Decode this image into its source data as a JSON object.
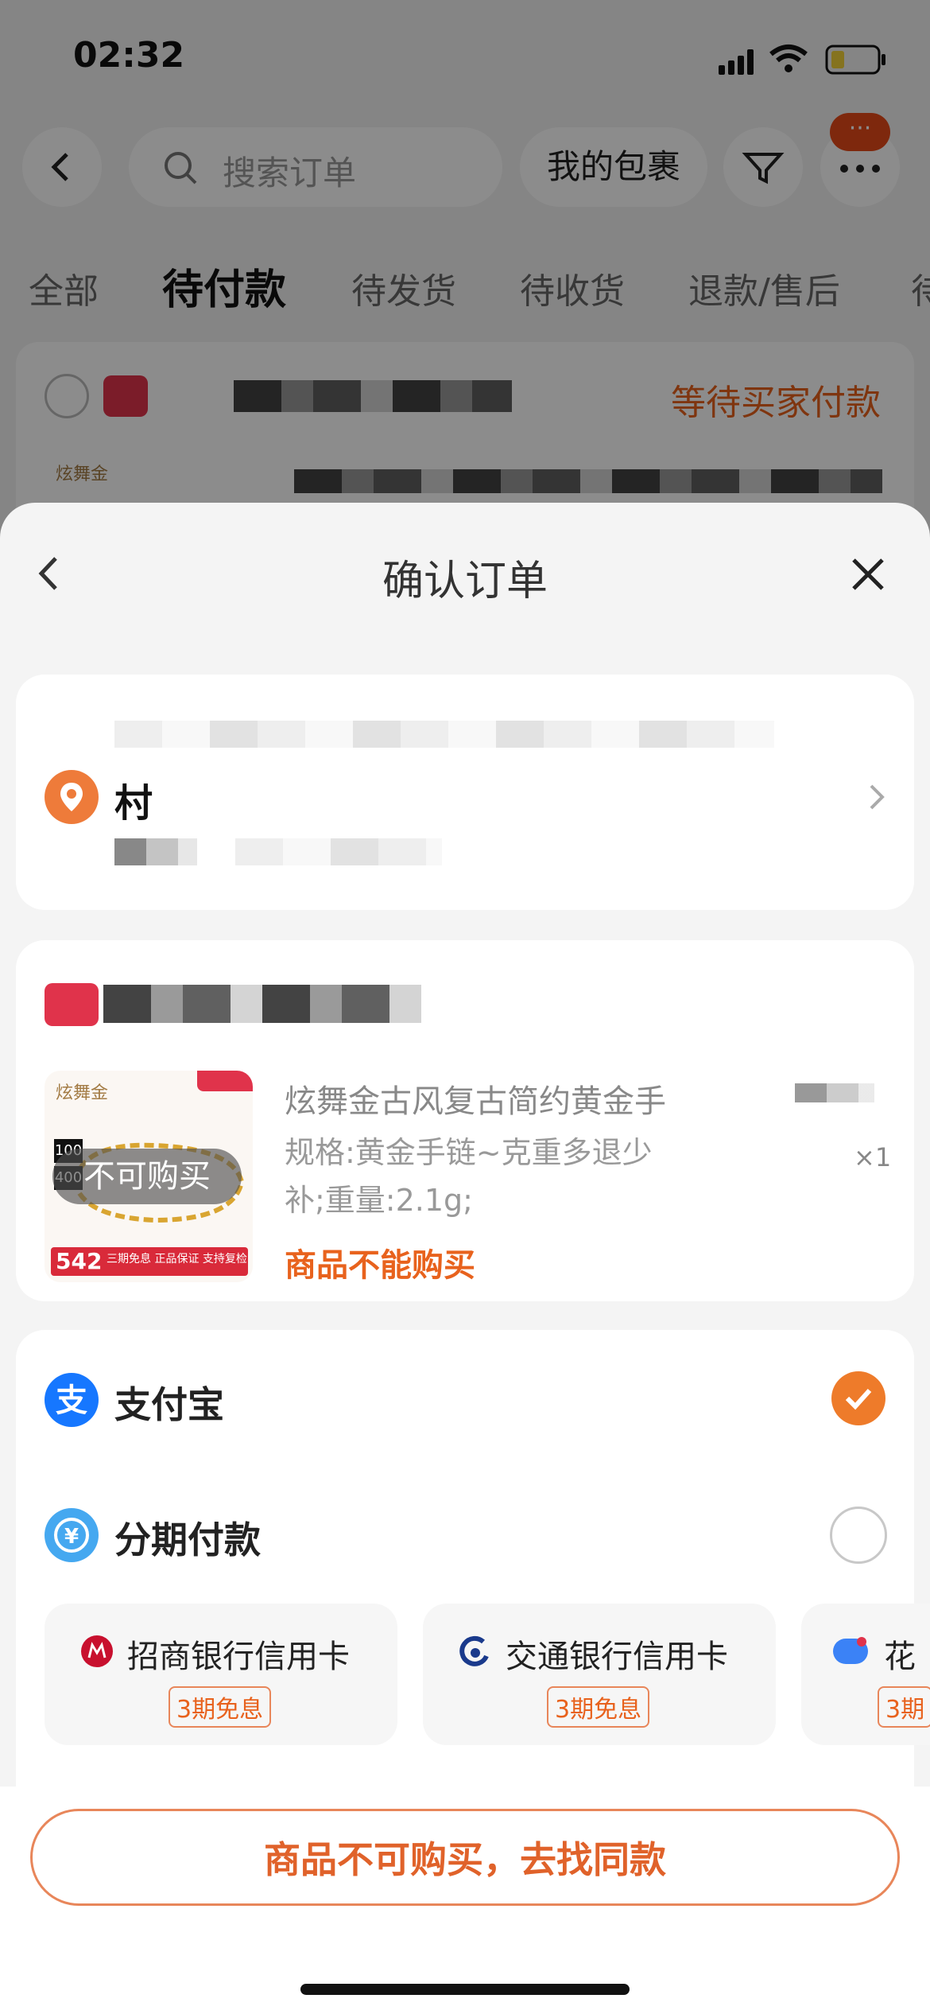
{
  "status_bar": {
    "time": "02:32"
  },
  "background": {
    "search_placeholder": "搜索订单",
    "my_parcels": "我的包裹",
    "more_badge": "···",
    "tabs": [
      "全部",
      "待付款",
      "待发货",
      "待收货",
      "退款/售后",
      "待"
    ],
    "active_tab_index": 1,
    "order_status": "等待买家付款",
    "shop_thumb_text": "炫舞金"
  },
  "sheet": {
    "title": "确认订单",
    "address": {
      "name": "村"
    },
    "product": {
      "brand": "炫舞金",
      "title": "炫舞金古风复古简约黄金手",
      "spec_line1": "规格:黄金手链~克重多退少",
      "spec_line2": "补;重量:2.1g;",
      "quantity": "×1",
      "overlay": "不可购买",
      "warning": "商品不能购买",
      "img_tag1": "100",
      "img_tag2": "400",
      "img_price": "542",
      "img_banner": "三期免息 正品保证 支持复检"
    },
    "payment": {
      "alipay": "支付宝",
      "installment": "分期付款",
      "banks": [
        {
          "name": "招商银行信用卡",
          "tag": "3期免息"
        },
        {
          "name": "交通银行信用卡",
          "tag": "3期免息"
        },
        {
          "name": "花",
          "tag": "3期"
        }
      ]
    },
    "cta": "商品不可购买，去找同款"
  },
  "colors": {
    "accent": "#e8621d",
    "alipay_blue": "#1677ff"
  }
}
